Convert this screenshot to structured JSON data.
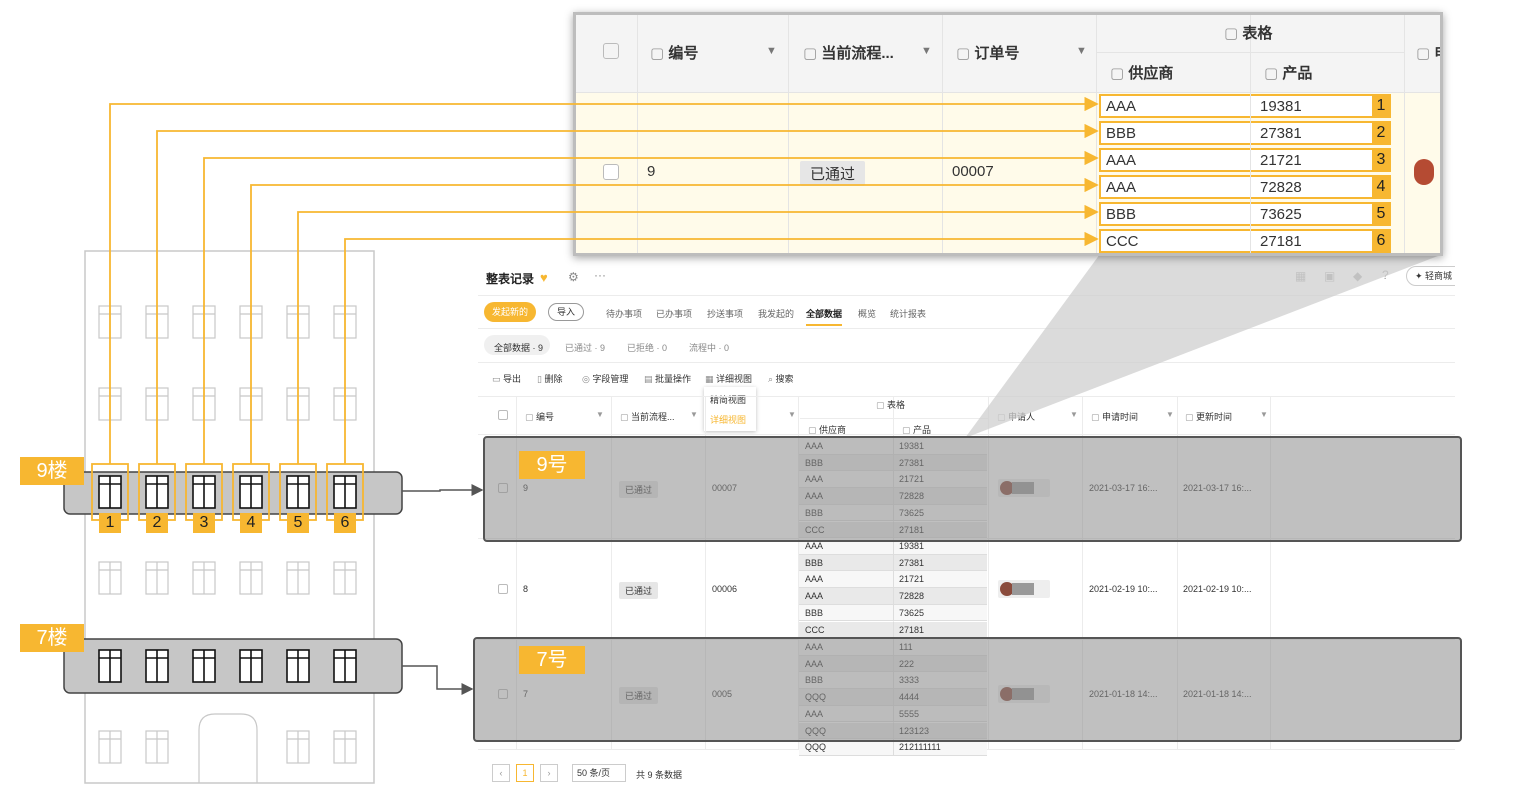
{
  "app": {
    "title": "整表记录",
    "brand_button": "轻商城",
    "tabs": [
      "待办事项",
      "已办事项",
      "抄送事项",
      "我发起的",
      "全部数据",
      "概览",
      "统计报表"
    ],
    "active_tab": "全部数据",
    "new_button": "发起新的",
    "import_button": "导入",
    "filters": [
      "全部数据 · 9",
      "已通过 · 9",
      "已拒绝 · 0",
      "流程中 · 0"
    ],
    "tools": {
      "export": "导出",
      "delete": "删除",
      "fields": "字段管理",
      "batch": "批量操作",
      "detail": "详细视图",
      "search": "搜索"
    },
    "view_menu": [
      "精简视图",
      "详细视图"
    ],
    "columns": {
      "id": "编号",
      "flow": "当前流程...",
      "order": "订单号",
      "group": "表格",
      "supplier": "供应商",
      "product": "产品",
      "applicant": "申请人",
      "apply_time": "申请时间",
      "update_time": "更新时间"
    },
    "rows": [
      {
        "id": "9",
        "flow": "已通过",
        "order": "00007",
        "apply_time": "2021-03-17 16:...",
        "update_time": "2021-03-17 16:...",
        "sub": [
          [
            "AAA",
            "19381"
          ],
          [
            "BBB",
            "27381"
          ],
          [
            "AAA",
            "21721"
          ],
          [
            "AAA",
            "72828"
          ],
          [
            "BBB",
            "73625"
          ],
          [
            "CCC",
            "27181"
          ]
        ]
      },
      {
        "id": "8",
        "flow": "已通过",
        "order": "00006",
        "apply_time": "2021-02-19 10:...",
        "update_time": "2021-02-19 10:...",
        "sub": [
          [
            "AAA",
            "19381"
          ],
          [
            "BBB",
            "27381"
          ],
          [
            "AAA",
            "21721"
          ],
          [
            "AAA",
            "72828"
          ],
          [
            "BBB",
            "73625"
          ],
          [
            "CCC",
            "27181"
          ]
        ]
      },
      {
        "id": "7",
        "flow": "已通过",
        "order": "0005",
        "apply_time": "2021-01-18 14:...",
        "update_time": "2021-01-18 14:...",
        "sub": [
          [
            "AAA",
            "111"
          ],
          [
            "AAA",
            "222"
          ],
          [
            "BBB",
            "3333"
          ],
          [
            "QQQ",
            "4444"
          ],
          [
            "AAA",
            "5555"
          ],
          [
            "QQQ",
            "123123"
          ],
          [
            "QQQ",
            "212111111"
          ]
        ]
      }
    ],
    "pagination": {
      "page": "1",
      "per_page": "50 条/页",
      "total": "共 9 条数据"
    }
  },
  "zoom": {
    "columns": {
      "id": "编号",
      "flow": "当前流程...",
      "order": "订单号",
      "group": "表格",
      "supplier": "供应商",
      "product": "产品",
      "applicant": "申"
    },
    "row": {
      "id": "9",
      "flow": "已通过",
      "order": "00007"
    },
    "sub": [
      [
        "AAA",
        "19381",
        "1"
      ],
      [
        "BBB",
        "27381",
        "2"
      ],
      [
        "AAA",
        "21721",
        "3"
      ],
      [
        "AAA",
        "72828",
        "4"
      ],
      [
        "BBB",
        "73625",
        "5"
      ],
      [
        "CCC",
        "27181",
        "6"
      ]
    ]
  },
  "building": {
    "floor9": "9楼",
    "floor7": "7楼",
    "windows": [
      "1",
      "2",
      "3",
      "4",
      "5",
      "6"
    ]
  },
  "labels": {
    "row9": "9号",
    "row7": "7号"
  },
  "colors": {
    "accent": "#f7b731",
    "highlight": "#8c8c8c"
  }
}
